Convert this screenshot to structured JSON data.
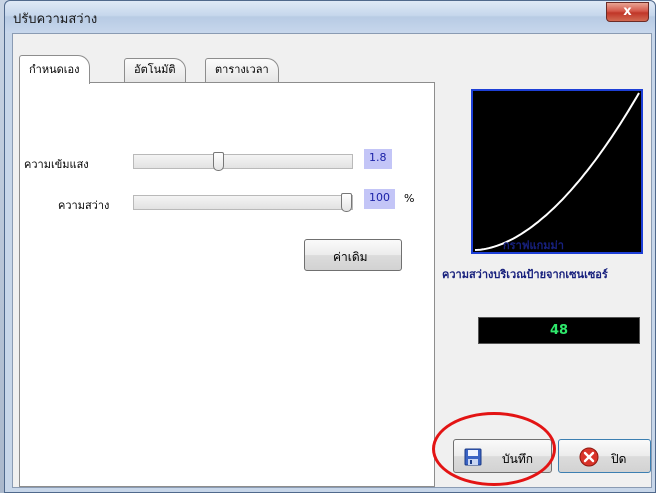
{
  "window": {
    "title": "ปรับความสว่าง",
    "close_glyph": "x"
  },
  "tabs": [
    {
      "label": "กำหนดเอง",
      "active": true
    },
    {
      "label": "อัตโนมัติ",
      "active": false
    },
    {
      "label": "ตารางเวลา",
      "active": false
    }
  ],
  "gamma": {
    "label": "ความเข้มแสง",
    "value": "1.8",
    "level": 0.38
  },
  "brightness": {
    "label": "ความสว่าง",
    "value": "100",
    "unit": "%",
    "level": 1.0
  },
  "reset_button": {
    "label": "ค่าเดิม"
  },
  "gamma_graph": {
    "label": "กราฟแกมม่า",
    "curve_exponent": 1.8,
    "curve_color": "#ffffff",
    "background_color": "#000000",
    "border_color": "#1d3fd6"
  },
  "sensor": {
    "label": "ความสว่างบริเวณป้ายจากเซนเซอร์",
    "value": "48",
    "text_color": "#2ee86b"
  },
  "save_button": {
    "label": "บันทึก",
    "icon": "floppy-disk-icon"
  },
  "close_button": {
    "label": "ปิด",
    "icon": "close-circle-icon"
  },
  "annotation": {
    "color": "#e31414"
  }
}
